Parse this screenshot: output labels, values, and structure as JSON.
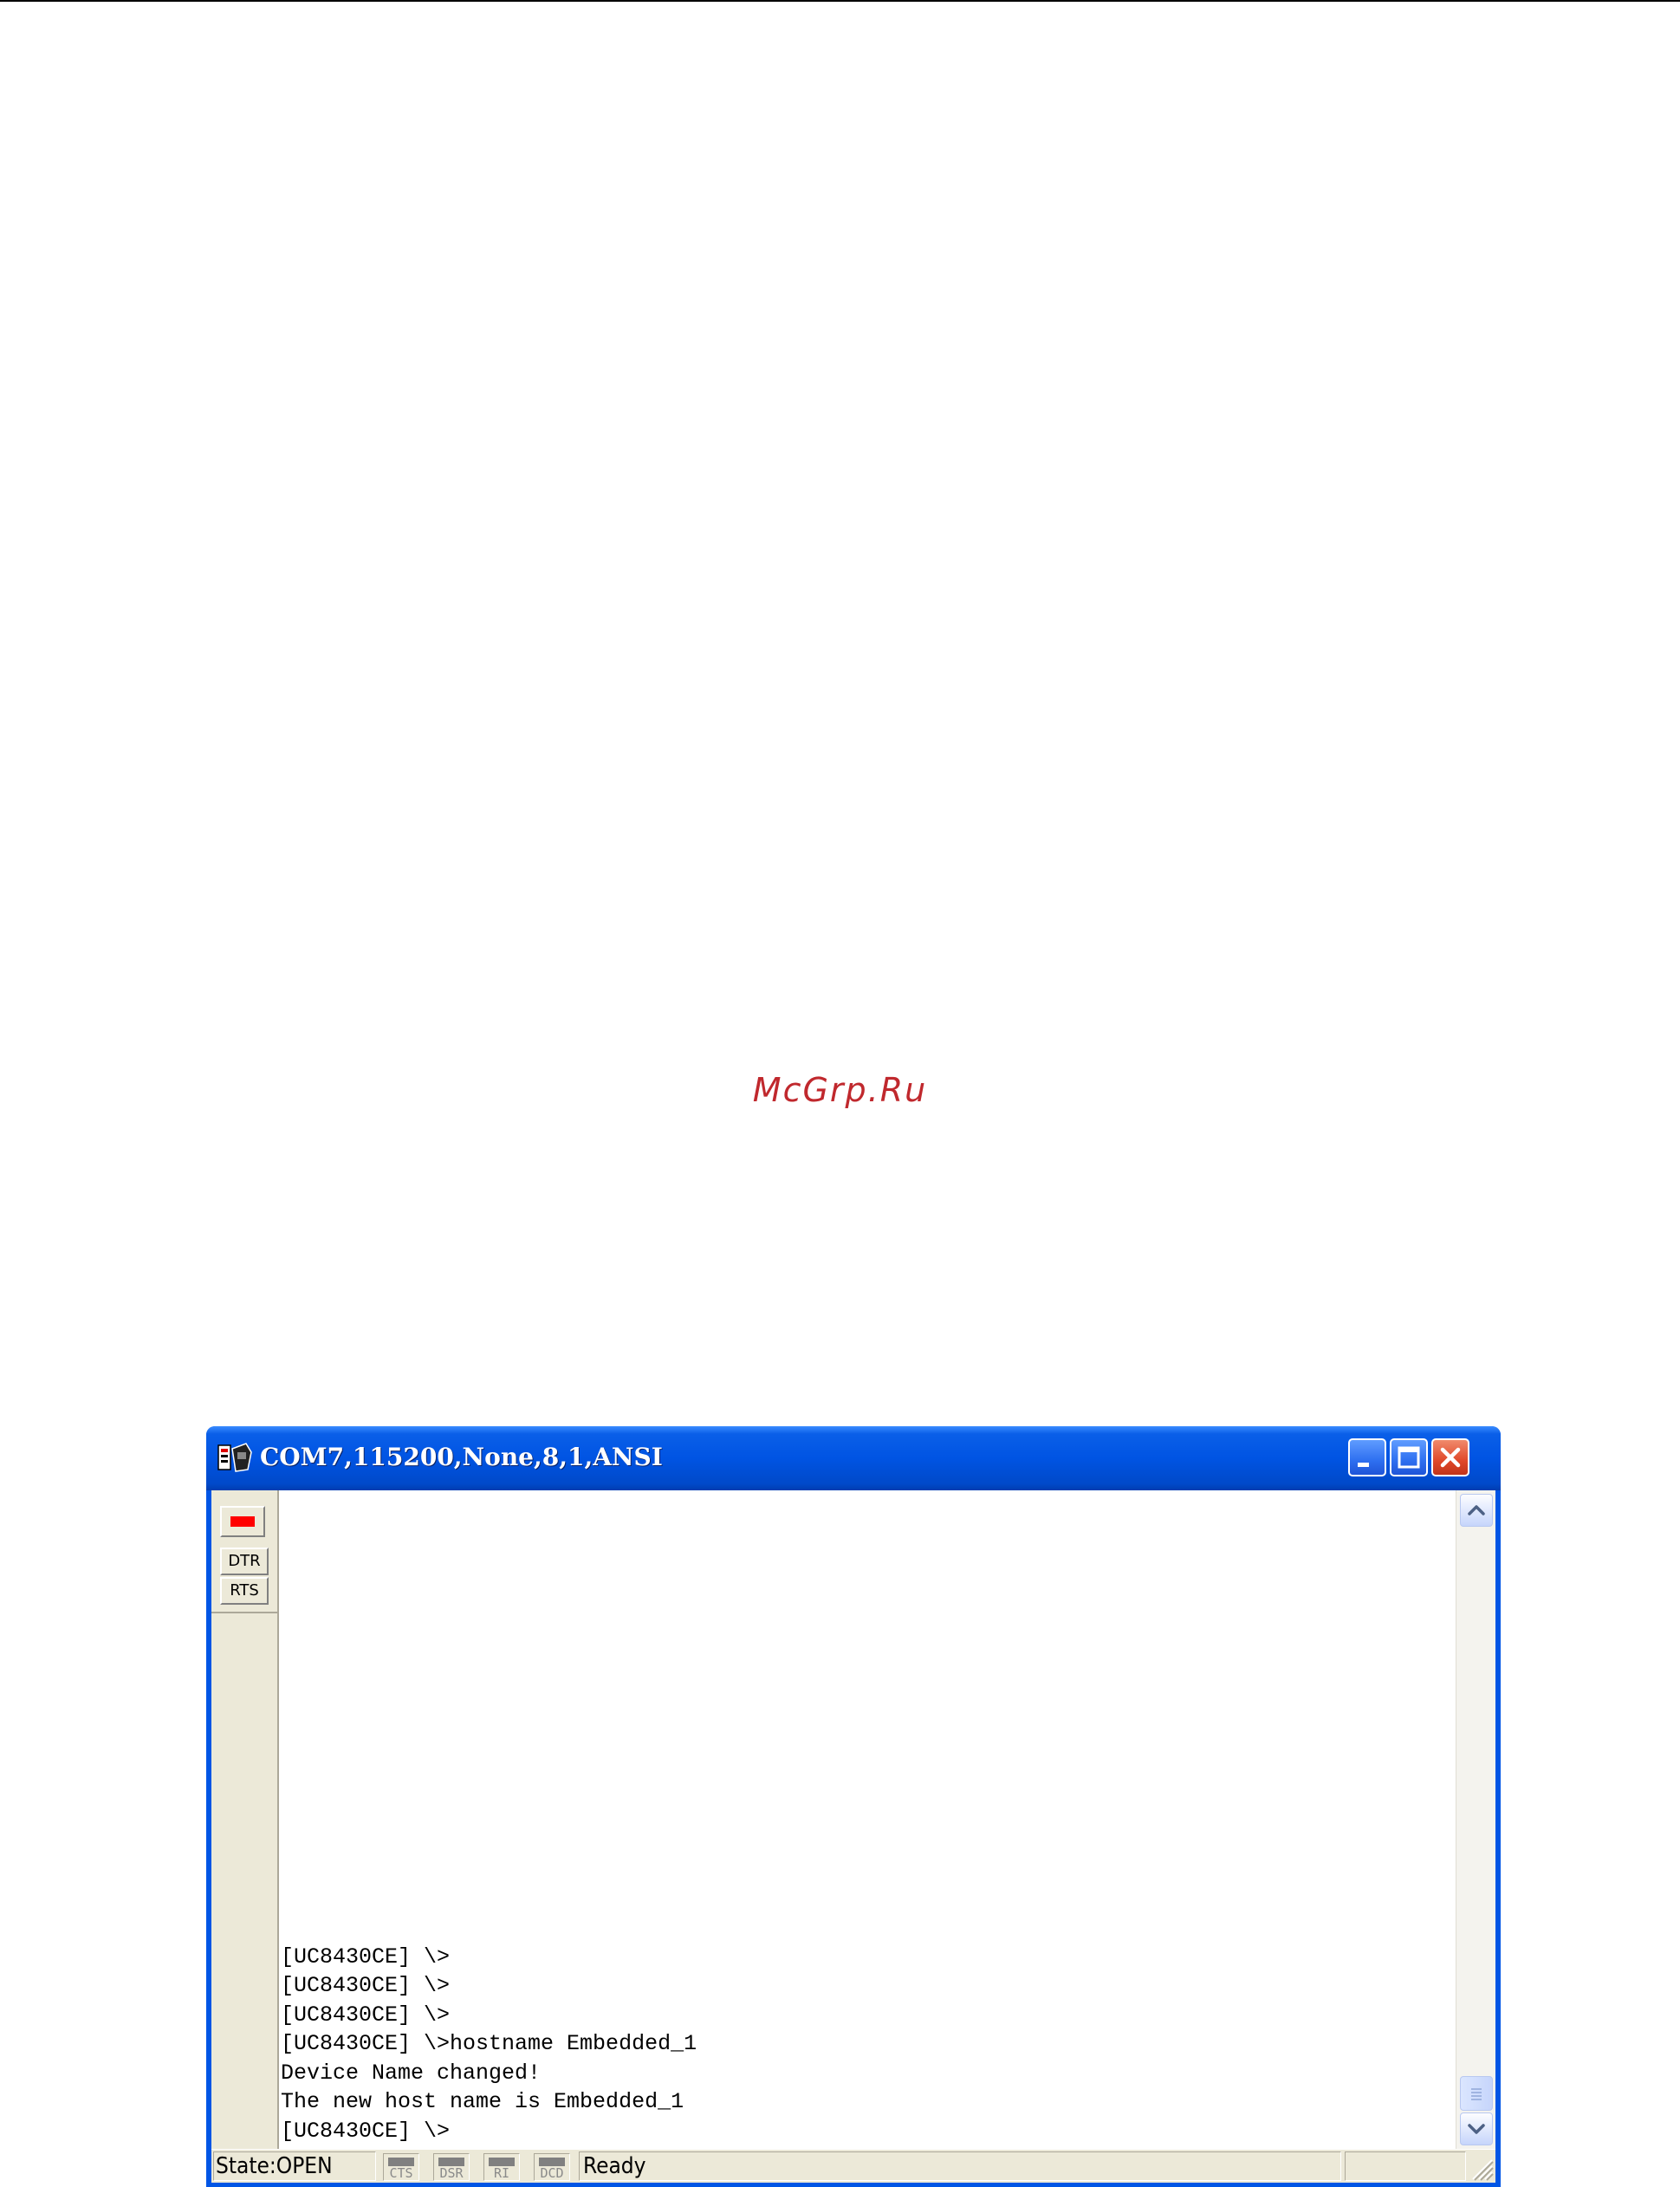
{
  "watermark": "McGrp.Ru",
  "window": {
    "title": "COM7,115200,None,8,1,ANSI",
    "controls": {
      "minimize": "minimize",
      "maximize": "maximize",
      "close": "close"
    }
  },
  "signals": {
    "indicator_color": "#ff0000",
    "dtr": "DTR",
    "rts": "RTS"
  },
  "terminal": {
    "lines": [
      "[UC8430CE] \\>",
      "[UC8430CE] \\>",
      "[UC8430CE] \\>",
      "[UC8430CE] \\>hostname Embedded_1",
      "Device Name changed!",
      "The new host name is Embedded_1",
      "[UC8430CE] \\>"
    ]
  },
  "statusbar": {
    "state": "State:OPEN",
    "indicators": [
      "CTS",
      "DSR",
      "RI",
      "DCD"
    ],
    "message": "Ready"
  },
  "colors": {
    "titlebar": "#0054e3",
    "close_button": "#e0482a",
    "panel": "#ece9d8"
  }
}
